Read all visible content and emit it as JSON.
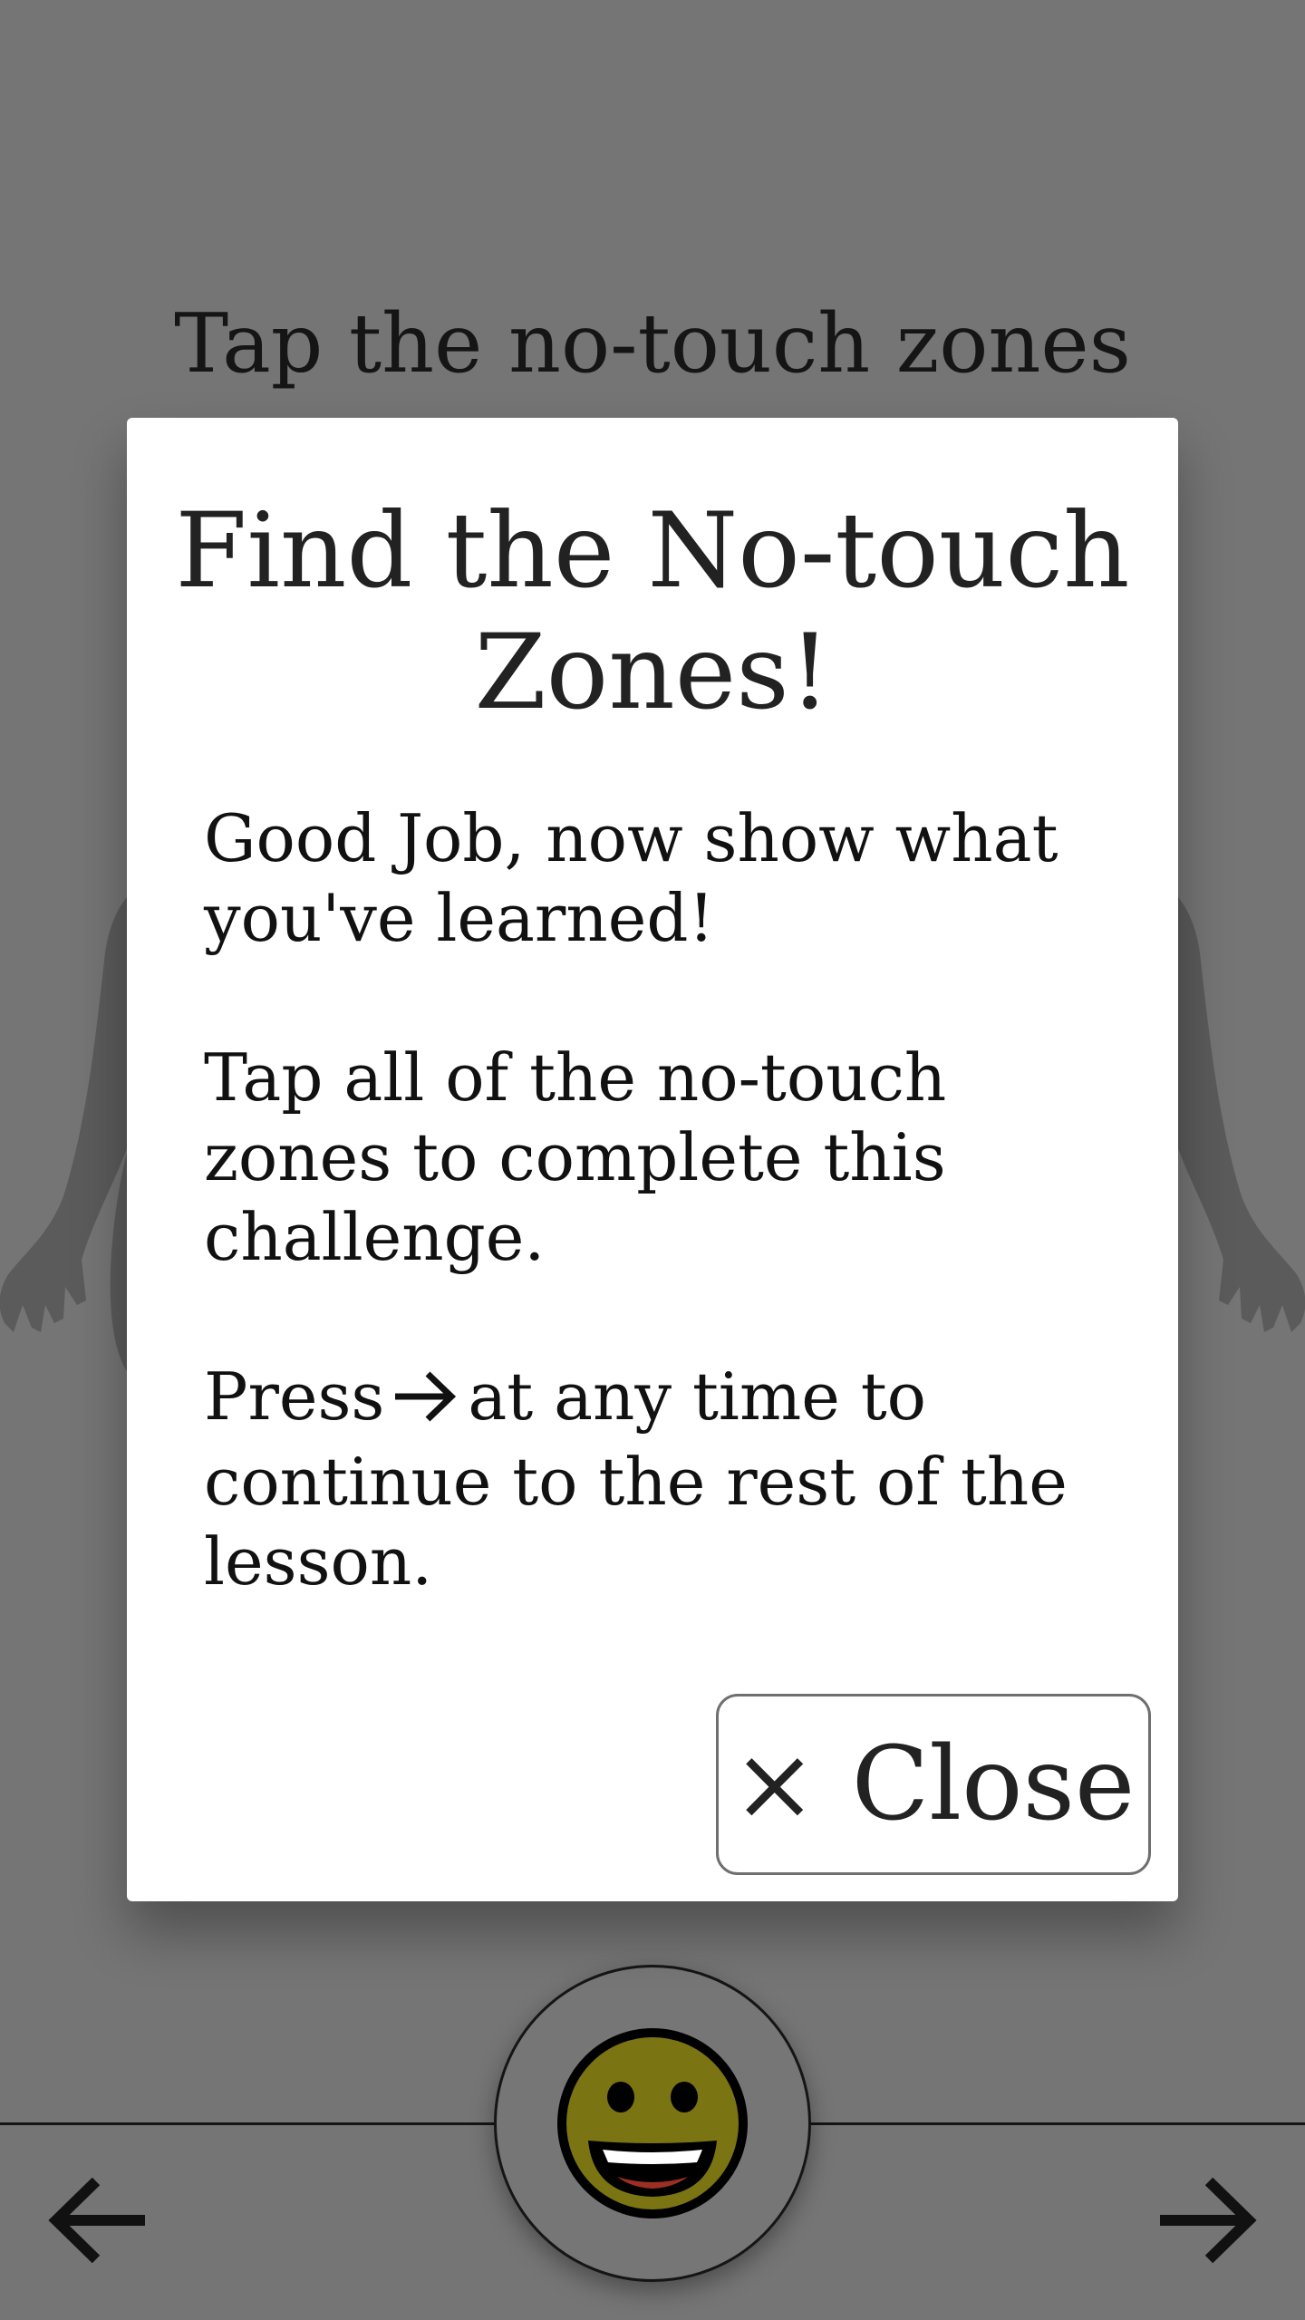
{
  "screen": {
    "prompt": "Tap the no-touch zones"
  },
  "dialog": {
    "title": "Find the No-touch Zones!",
    "paragraph_1": "Good Job, now show what you've learned!",
    "paragraph_2": "Tap all of the no-touch zones to complete this challenge.",
    "paragraph_3_before_icon": "Press",
    "paragraph_3_icon": "right-arrow-icon",
    "paragraph_3_after_icon": "at any time to continue to the rest of the lesson.",
    "close_icon": "×",
    "close_label": "Close"
  },
  "navigation": {
    "back_icon": "left-arrow-icon",
    "next_icon": "right-arrow-icon",
    "avatar_icon": "smiley-face-icon"
  },
  "colors": {
    "background_overlay": "#757575",
    "dialog_background": "#ffffff",
    "smiley_face": "#7a7413",
    "smiley_mouth": "#9c2f24"
  }
}
